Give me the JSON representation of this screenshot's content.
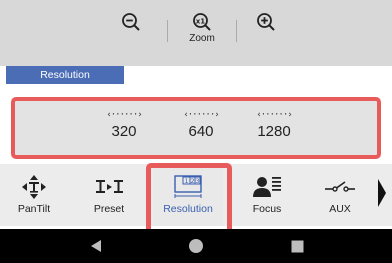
{
  "zoom_toolbar": {
    "zoom_out_icon": "magnifier-minus-icon",
    "zoom_reset_icon": "magnifier-x1-icon",
    "zoom_in_icon": "magnifier-plus-icon",
    "label": "Zoom"
  },
  "section": {
    "title": "Resolution"
  },
  "resolution_options": [
    {
      "value": "320"
    },
    {
      "value": "640"
    },
    {
      "value": "1280"
    }
  ],
  "tabs": [
    {
      "label": "PanTilt",
      "icon": "pantilt-icon"
    },
    {
      "label": "Preset",
      "icon": "preset-icon"
    },
    {
      "label": "Resolution",
      "icon": "resolution-icon",
      "active": true
    },
    {
      "label": "Focus",
      "icon": "focus-icon"
    },
    {
      "label": "AUX",
      "icon": "aux-switch-icon"
    }
  ],
  "colors": {
    "accent": "#4a6db6",
    "highlight": "#e85b5b",
    "toolbar_bg": "#d8d8d8",
    "navbar_bg": "#000000"
  },
  "navbar": {
    "back_icon": "back-triangle-icon",
    "home_icon": "home-circle-icon",
    "recents_icon": "recents-square-icon"
  }
}
